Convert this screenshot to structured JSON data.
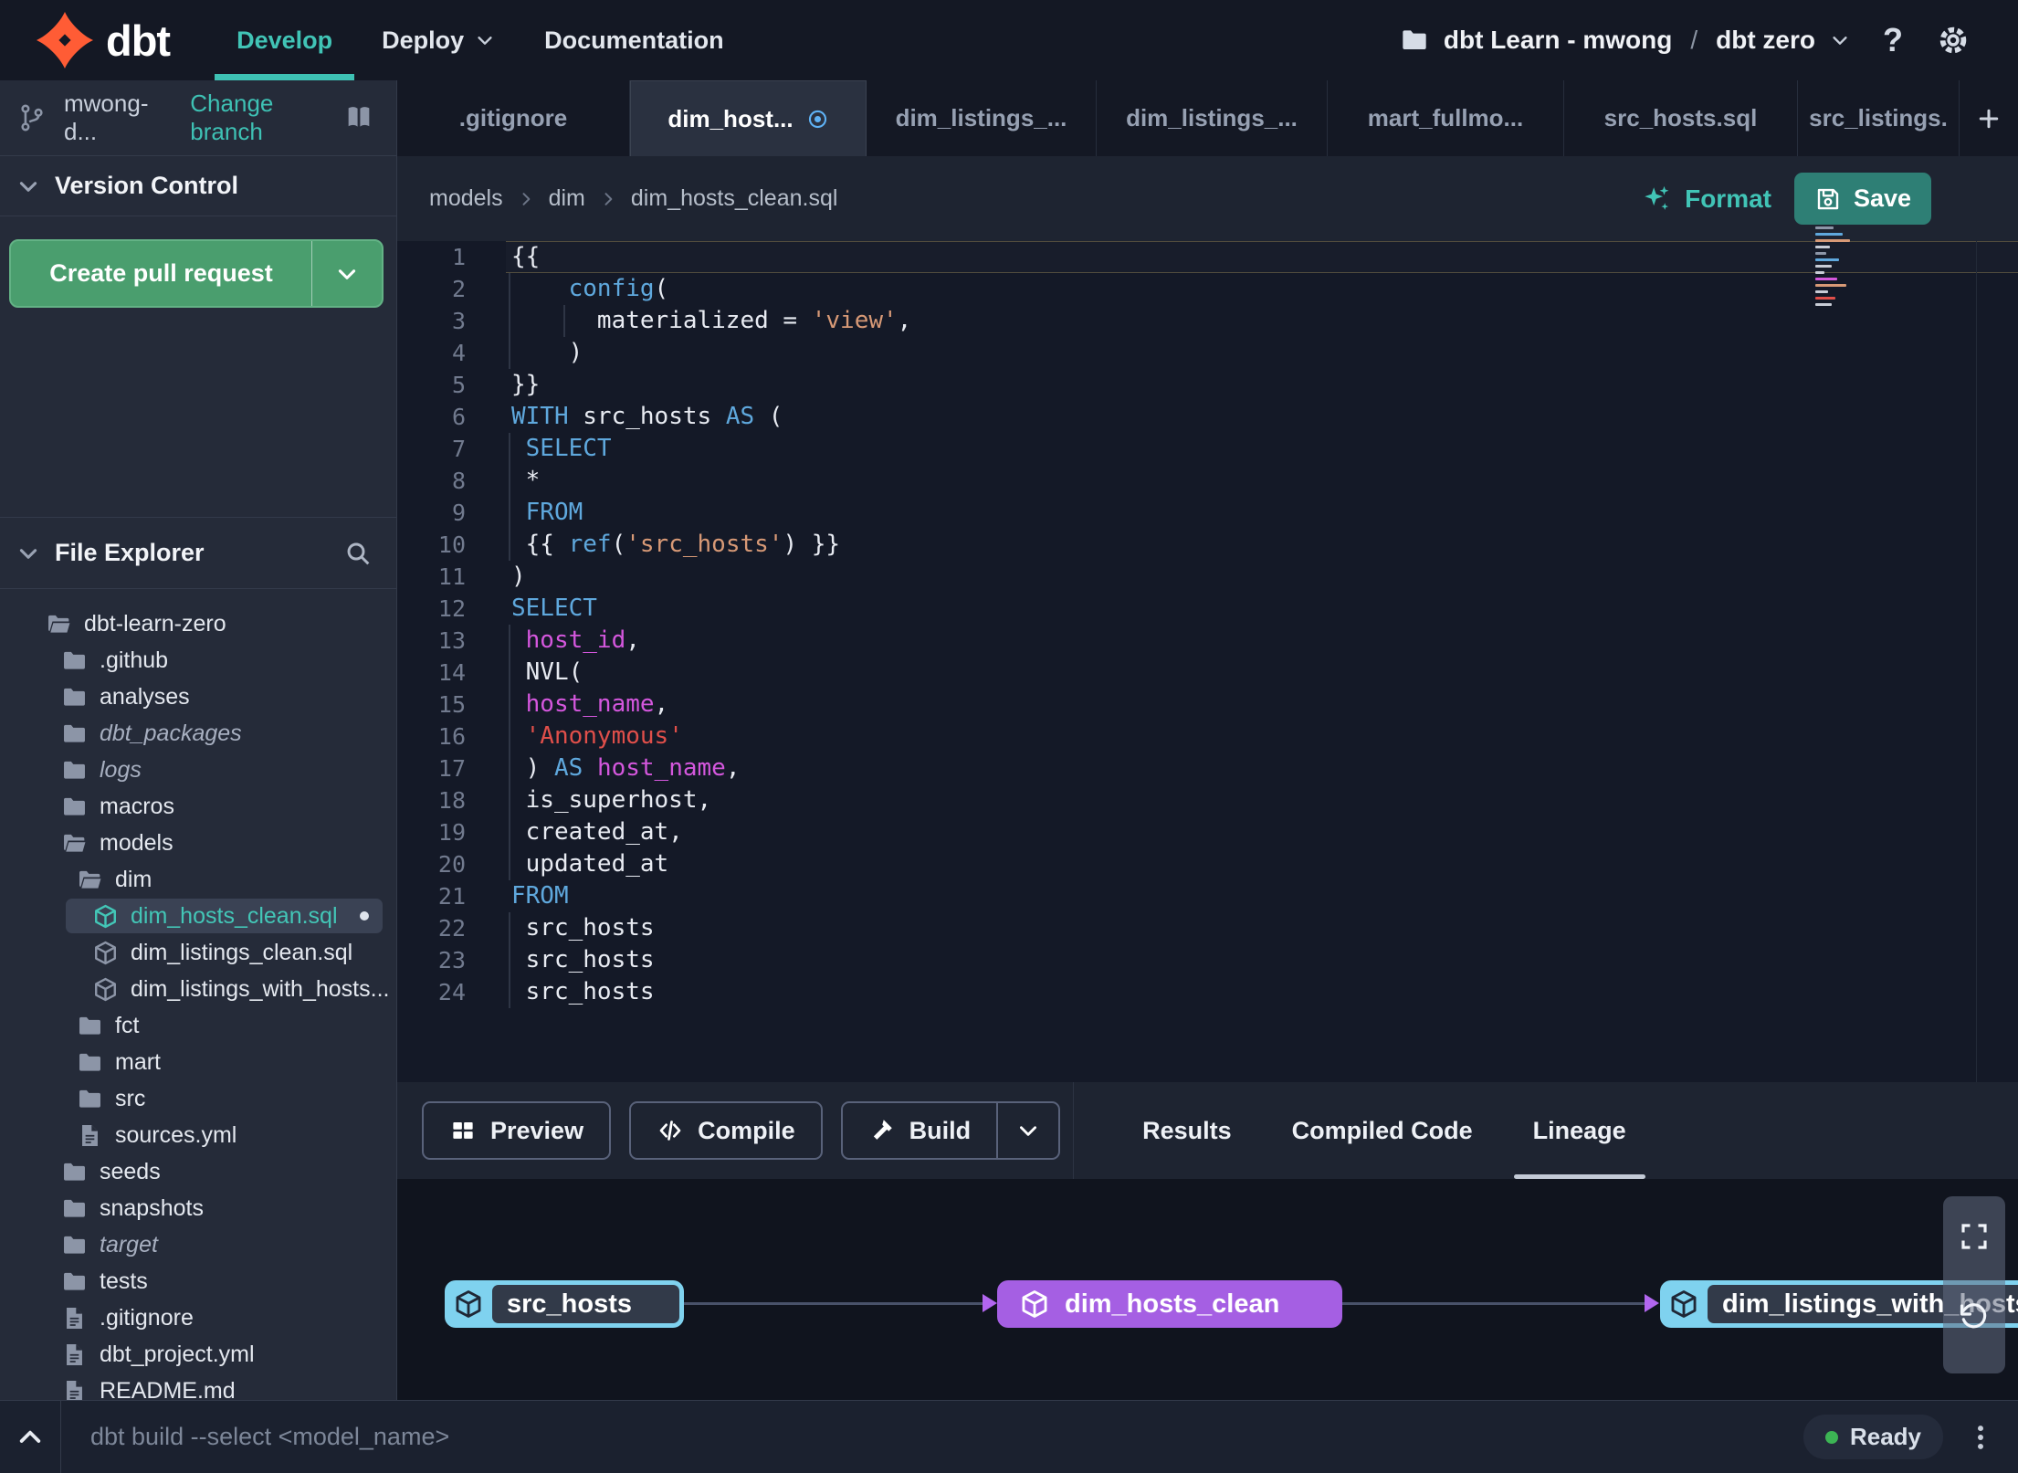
{
  "topbar": {
    "brand": "dbt",
    "nav": [
      {
        "label": "Develop",
        "active": true,
        "dropdown": false
      },
      {
        "label": "Deploy",
        "active": false,
        "dropdown": true
      },
      {
        "label": "Documentation",
        "active": false,
        "dropdown": false
      }
    ],
    "project_account": "dbt Learn - mwong",
    "project_separator": "/",
    "project_name": "dbt zero",
    "help_glyph": "?"
  },
  "sidebar": {
    "branch_name": "mwong-d...",
    "change_branch_label": "Change branch",
    "version_control_title": "Version Control",
    "create_pr_label": "Create pull request",
    "file_explorer_title": "File Explorer",
    "tree": [
      {
        "name": "dbt-learn-zero",
        "icon": "folder-open",
        "depth": 0
      },
      {
        "name": ".github",
        "icon": "folder",
        "depth": 1
      },
      {
        "name": "analyses",
        "icon": "folder",
        "depth": 1
      },
      {
        "name": "dbt_packages",
        "icon": "folder",
        "depth": 1,
        "italic": true
      },
      {
        "name": "logs",
        "icon": "folder",
        "depth": 1,
        "italic": true
      },
      {
        "name": "macros",
        "icon": "folder",
        "depth": 1
      },
      {
        "name": "models",
        "icon": "folder-open",
        "depth": 1
      },
      {
        "name": "dim",
        "icon": "folder-open",
        "depth": 2
      },
      {
        "name": "dim_hosts_clean.sql",
        "icon": "model",
        "depth": 3,
        "selected": true,
        "modified": true
      },
      {
        "name": "dim_listings_clean.sql",
        "icon": "model",
        "depth": 3
      },
      {
        "name": "dim_listings_with_hosts...",
        "icon": "model",
        "depth": 3
      },
      {
        "name": "fct",
        "icon": "folder",
        "depth": 2
      },
      {
        "name": "mart",
        "icon": "folder",
        "depth": 2
      },
      {
        "name": "src",
        "icon": "folder",
        "depth": 2
      },
      {
        "name": "sources.yml",
        "icon": "file",
        "depth": 2
      },
      {
        "name": "seeds",
        "icon": "folder",
        "depth": 1
      },
      {
        "name": "snapshots",
        "icon": "folder",
        "depth": 1
      },
      {
        "name": "target",
        "icon": "folder",
        "depth": 1,
        "italic": true
      },
      {
        "name": "tests",
        "icon": "folder",
        "depth": 1
      },
      {
        "name": ".gitignore",
        "icon": "file",
        "depth": 1
      },
      {
        "name": "dbt_project.yml",
        "icon": "file",
        "depth": 1
      },
      {
        "name": "README.md",
        "icon": "file",
        "depth": 1
      }
    ]
  },
  "tabs": [
    {
      "label": ".gitignore"
    },
    {
      "label": "dim_host...",
      "active": true,
      "modified": true
    },
    {
      "label": "dim_listings_..."
    },
    {
      "label": "dim_listings_..."
    },
    {
      "label": "mart_fullmo..."
    },
    {
      "label": "src_hosts.sql"
    },
    {
      "label": "src_listings."
    }
  ],
  "editor": {
    "breadcrumb": [
      "models",
      "dim",
      "dim_hosts_clean.sql"
    ],
    "format_label": "Format",
    "save_label": "Save",
    "lines": [
      {
        "n": 1,
        "current": true,
        "tokens": [
          [
            "{{",
            "p"
          ]
        ]
      },
      {
        "n": 2,
        "guides": [
          0
        ],
        "tokens": [
          [
            "    ",
            "p"
          ],
          [
            "config",
            "kw"
          ],
          [
            "(",
            "p"
          ]
        ]
      },
      {
        "n": 3,
        "guides": [
          0,
          60
        ],
        "tokens": [
          [
            "      ",
            "p"
          ],
          [
            "materialized = ",
            "p"
          ],
          [
            "'view'",
            "str"
          ],
          [
            ",",
            "p"
          ]
        ]
      },
      {
        "n": 4,
        "guides": [
          0
        ],
        "tokens": [
          [
            "    )",
            "p"
          ]
        ]
      },
      {
        "n": 5,
        "tokens": [
          [
            "}}",
            "p"
          ]
        ]
      },
      {
        "n": 6,
        "tokens": [
          [
            "WITH",
            "kw"
          ],
          [
            " src_hosts ",
            "p"
          ],
          [
            "AS",
            "kw"
          ],
          [
            " (",
            "p"
          ]
        ]
      },
      {
        "n": 7,
        "guides": [
          0
        ],
        "tokens": [
          [
            " ",
            "p"
          ],
          [
            "SELECT",
            "kw"
          ]
        ]
      },
      {
        "n": 8,
        "guides": [
          0
        ],
        "tokens": [
          [
            " *",
            "p"
          ]
        ]
      },
      {
        "n": 9,
        "guides": [
          0
        ],
        "tokens": [
          [
            " ",
            "p"
          ],
          [
            "FROM",
            "kw"
          ]
        ]
      },
      {
        "n": 10,
        "guides": [
          0
        ],
        "tokens": [
          [
            " {{ ",
            "p"
          ],
          [
            "ref",
            "kw"
          ],
          [
            "(",
            "p"
          ],
          [
            "'src_hosts'",
            "str"
          ],
          [
            ") }}",
            "p"
          ]
        ]
      },
      {
        "n": 11,
        "tokens": [
          [
            ")",
            "p"
          ]
        ]
      },
      {
        "n": 12,
        "tokens": [
          [
            "SELECT",
            "kw"
          ]
        ]
      },
      {
        "n": 13,
        "guides": [
          0
        ],
        "tokens": [
          [
            " ",
            "p"
          ],
          [
            "host_id",
            "var"
          ],
          [
            ",",
            "p"
          ]
        ]
      },
      {
        "n": 14,
        "guides": [
          0
        ],
        "tokens": [
          [
            " NVL(",
            "p"
          ]
        ]
      },
      {
        "n": 15,
        "guides": [
          0
        ],
        "tokens": [
          [
            " ",
            "p"
          ],
          [
            "host_name",
            "var"
          ],
          [
            ",",
            "p"
          ]
        ]
      },
      {
        "n": 16,
        "guides": [
          0
        ],
        "tokens": [
          [
            " ",
            "p"
          ],
          [
            "'Anonymous'",
            "err"
          ]
        ]
      },
      {
        "n": 17,
        "guides": [
          0
        ],
        "tokens": [
          [
            " ) ",
            "p"
          ],
          [
            "AS",
            "kw"
          ],
          [
            " ",
            "p"
          ],
          [
            "host_name",
            "var"
          ],
          [
            ",",
            "p"
          ]
        ]
      },
      {
        "n": 18,
        "guides": [
          0
        ],
        "tokens": [
          [
            " is_superhost,",
            "p"
          ]
        ]
      },
      {
        "n": 19,
        "guides": [
          0
        ],
        "tokens": [
          [
            " created_at,",
            "p"
          ]
        ]
      },
      {
        "n": 20,
        "guides": [
          0
        ],
        "tokens": [
          [
            " updated_at",
            "p"
          ]
        ]
      },
      {
        "n": 21,
        "tokens": [
          [
            "FROM",
            "kw"
          ]
        ]
      },
      {
        "n": 22,
        "guides": [
          0
        ],
        "tokens": [
          [
            " src_hosts",
            "p"
          ]
        ]
      },
      {
        "n": 23,
        "guides": [
          0
        ],
        "tokens": [
          [
            " src_hosts",
            "p"
          ]
        ]
      },
      {
        "n": 24,
        "guides": [
          0
        ],
        "tokens": [
          [
            " src_hosts",
            "p"
          ]
        ]
      }
    ]
  },
  "action_bar": {
    "buttons": [
      {
        "label": "Preview",
        "icon": "table"
      },
      {
        "label": "Compile",
        "icon": "code"
      },
      {
        "label": "Build",
        "icon": "hammer",
        "split": true
      }
    ],
    "tabs": [
      {
        "label": "Results"
      },
      {
        "label": "Compiled Code"
      },
      {
        "label": "Lineage",
        "active": true
      }
    ]
  },
  "lineage": {
    "nodes": [
      {
        "label": "src_hosts",
        "variant": "source"
      },
      {
        "label": "dim_hosts_clean",
        "variant": "model"
      },
      {
        "label": "dim_listings_with_hosts",
        "variant": "source"
      }
    ]
  },
  "statusbar": {
    "command": "dbt build --select <model_name>",
    "status": "Ready"
  },
  "colors": {
    "accent_teal": "#41c4b6",
    "pr_green": "#4a9e6e",
    "save_teal": "#2e7f75",
    "node_purple": "#a55fe3",
    "node_blue": "#7fd2ef",
    "modified_blue": "#5fb2f5",
    "ready_green": "#3cb454",
    "keyword_blue": "#5fa8dd",
    "string_orange": "#d79976",
    "string_red": "#e04f4a",
    "identifier_magenta": "#d457dd"
  }
}
